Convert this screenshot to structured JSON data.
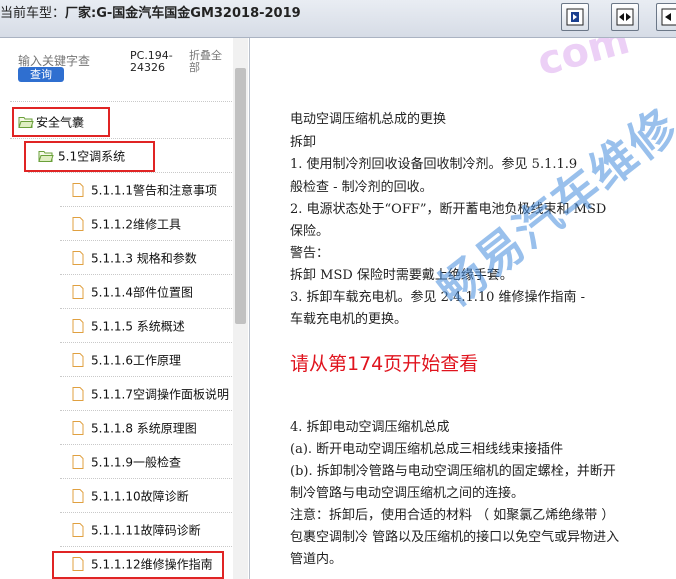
{
  "header": {
    "car_label": "当前车型：",
    "car_value": "厂家:G-国金汽车国金GM32018-2019",
    "buttons": [
      "view-single",
      "view-dual",
      "view-prev"
    ]
  },
  "sidebar": {
    "search_placeholder": "输入关键字查",
    "search_button": "查询",
    "pc_code": "PC.194-24326",
    "collapse_label": "折叠全部",
    "tree": [
      {
        "label": "安全气囊",
        "type": "folder",
        "highlight": true
      },
      {
        "label": "5.1空调系统",
        "type": "folder",
        "highlight": true
      },
      {
        "label": "5.1.1.1警告和注意事项",
        "type": "file"
      },
      {
        "label": "5.1.1.2维修工具",
        "type": "file"
      },
      {
        "label": "5.1.1.3 规格和参数",
        "type": "file"
      },
      {
        "label": "5.1.1.4部件位置图",
        "type": "file"
      },
      {
        "label": "5.1.1.5 系统概述",
        "type": "file"
      },
      {
        "label": "5.1.1.6工作原理",
        "type": "file"
      },
      {
        "label": "5.1.1.7空调操作面板说明",
        "type": "file"
      },
      {
        "label": "5.1.1.8 系统原理图",
        "type": "file"
      },
      {
        "label": "5.1.1.9一般检查",
        "type": "file"
      },
      {
        "label": "5.1.1.10故障诊断",
        "type": "file"
      },
      {
        "label": "5.1.1.11故障码诊断",
        "type": "file"
      },
      {
        "label": "5.1.1.12维修操作指南",
        "type": "file",
        "highlight": true
      }
    ]
  },
  "document": {
    "lines": [
      "电动空调压缩机总成的更换",
      "拆卸",
      "1.   使用制冷剂回收设备回收制冷剂。参见  5.1.1.9",
      "般检查 - 制冷剂的回收。",
      "2.   电源状态处于“OFF”，断开蓄电池负极线束和 MSD",
      "  保险。",
      "警告：",
      "拆卸 MSD 保险时需要戴上绝缘手套。",
      "3.   拆卸车载充电机。参见 2.4.1.10 维修操作指南 -",
      "车载充电机的更换。"
    ],
    "notice": "请从第174页开始查看",
    "lines2": [
      "4.   拆卸电动空调压缩机总成",
      "(a). 断开电动空调压缩机总成三相线线束接插件",
      "(b). 拆卸制冷管路与电动空调压缩机的固定螺栓，并断开",
      "制冷管路与电动空调压缩机之间的连接。",
      "注意：拆卸后，使用合适的材料 （ 如聚氯乙烯绝缘带 ）",
      "包裹空调制冷 管路以及压缩机的接口以免空气或异物进入",
      "管道内。"
    ],
    "watermark": "畅易汽车维修",
    "watermark_small": "com"
  },
  "colors": {
    "highlight_box": "#e02424",
    "notice": "#e0141e",
    "search_button": "#2f6fd0"
  }
}
